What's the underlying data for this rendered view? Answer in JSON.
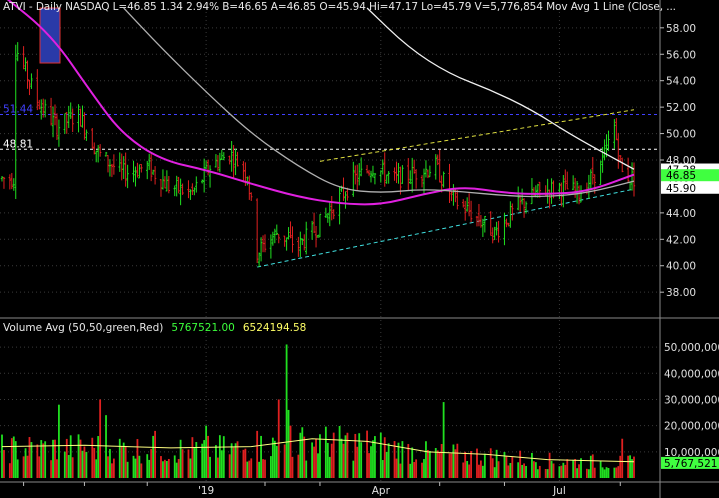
{
  "header": {
    "ticker_line": "ATVI - Daily  NASDAQ  L=46.85  1.34  2.94%  B=46.65  A=46.85  O=45.94  Hi=47.17  Lo=45.79  V=5,776,854  Mov Avg 1 Line (Close, ..."
  },
  "volume_header": {
    "label": "Volume Avg (50,50,green,Red)",
    "avg_value": "5767521.00",
    "prev_value": "6524194.58"
  },
  "colors": {
    "background": "#000000",
    "grid": "#3a3a3a",
    "up": "#20e020",
    "down": "#e02020",
    "ma_magenta": "#e020e0",
    "ma_gray": "#b0b0b0",
    "ma_white": "#f0f0f0",
    "trend_lower": "#40e0e0",
    "trend_upper": "#e0e040",
    "level_blue": "#4040ff",
    "level_white": "#ffffff",
    "last_price": "#40ff40",
    "vol_avg": "#ffff80"
  },
  "chart_data": [
    {
      "type": "candlestick",
      "title": "ATVI - Daily NASDAQ",
      "ylim": [
        36.5,
        59.5
      ],
      "y_ticks": [
        "58.00",
        "56.00",
        "54.00",
        "52.00",
        "50.00",
        "48.00",
        "44.00",
        "42.00",
        "40.00",
        "38.00"
      ],
      "x_ticks": [
        "'19",
        "Apr",
        "Jul"
      ],
      "horizontal_levels": [
        {
          "label": "51.44",
          "value": 51.44,
          "color": "blue"
        },
        {
          "label": "48.81",
          "value": 48.81,
          "color": "white"
        }
      ],
      "price_tags": [
        {
          "label": "47.28",
          "value": 47.28
        },
        {
          "label": "46.66",
          "value": 46.66
        },
        {
          "label": "45.90",
          "value": 45.9
        }
      ],
      "last_price": {
        "label": "46.85",
        "value": 46.85
      },
      "trendlines": [
        {
          "name": "lower-support",
          "points": [
            [
              "2019-01-28",
              39.9
            ],
            [
              "2019-08-08",
              45.8
            ]
          ]
        },
        {
          "name": "upper-resistance",
          "points": [
            [
              "2019-03-01",
              47.9
            ],
            [
              "2019-08-08",
              51.8
            ]
          ]
        }
      ],
      "moving_averages": [
        {
          "name": "magenta",
          "points": [
            [
              "2018-09-20",
              60.5
            ],
            [
              "2018-10-15",
              57.5
            ],
            [
              "2018-11-05",
              53.0
            ],
            [
              "2018-11-20",
              50.0
            ],
            [
              "2018-12-10",
              48.0
            ],
            [
              "2019-01-03",
              47.2
            ],
            [
              "2019-01-25",
              46.2
            ],
            [
              "2019-02-18",
              45.2
            ],
            [
              "2019-03-11",
              44.7
            ],
            [
              "2019-04-01",
              44.6
            ],
            [
              "2019-04-22",
              45.4
            ],
            [
              "2019-05-13",
              46.0
            ],
            [
              "2019-06-03",
              45.5
            ],
            [
              "2019-06-24",
              45.4
            ],
            [
              "2019-07-15",
              45.6
            ],
            [
              "2019-08-08",
              46.9
            ]
          ]
        },
        {
          "name": "gray",
          "points": [
            [
              "2018-11-21",
              59.5
            ],
            [
              "2018-12-10",
              56.5
            ],
            [
              "2019-01-03",
              53.0
            ],
            [
              "2019-01-25",
              50.0
            ],
            [
              "2019-02-18",
              47.5
            ],
            [
              "2019-03-11",
              45.8
            ],
            [
              "2019-04-01",
              45.5
            ],
            [
              "2019-04-22",
              45.8
            ],
            [
              "2019-05-13",
              45.6
            ],
            [
              "2019-06-03",
              45.3
            ],
            [
              "2019-06-24",
              45.2
            ],
            [
              "2019-07-15",
              45.5
            ],
            [
              "2019-08-08",
              46.4
            ]
          ]
        },
        {
          "name": "white",
          "points": [
            [
              "2019-03-25",
              59.5
            ],
            [
              "2019-04-15",
              56.5
            ],
            [
              "2019-05-06",
              54.5
            ],
            [
              "2019-05-27",
              53.3
            ],
            [
              "2019-06-17",
              51.8
            ],
            [
              "2019-07-08",
              49.8
            ],
            [
              "2019-08-08",
              47.3
            ]
          ]
        }
      ],
      "anchors": [
        [
          "2018-09-27",
          56.5
        ],
        [
          "2018-10-08",
          52.5
        ],
        [
          "2018-10-18",
          50.5
        ],
        [
          "2018-10-29",
          51.5
        ],
        [
          "2018-11-08",
          48.5
        ],
        [
          "2018-11-20",
          47.0
        ],
        [
          "2018-12-03",
          47.5
        ],
        [
          "2018-12-14",
          46.0
        ],
        [
          "2018-12-26",
          45.5
        ],
        [
          "2019-01-04",
          47.5
        ],
        [
          "2019-01-14",
          48.5
        ],
        [
          "2019-01-23",
          47.0
        ],
        [
          "2019-01-28",
          41.0
        ],
        [
          "2019-02-07",
          42.5
        ],
        [
          "2019-02-18",
          41.5
        ],
        [
          "2019-02-28",
          43.0
        ],
        [
          "2019-03-08",
          44.5
        ],
        [
          "2019-03-18",
          46.5
        ],
        [
          "2019-03-28",
          47.5
        ],
        [
          "2019-04-08",
          46.5
        ],
        [
          "2019-04-18",
          47.0
        ],
        [
          "2019-04-29",
          47.5
        ],
        [
          "2019-05-08",
          45.0
        ],
        [
          "2019-05-17",
          44.0
        ],
        [
          "2019-05-29",
          42.5
        ],
        [
          "2019-06-10",
          44.5
        ],
        [
          "2019-06-20",
          45.5
        ],
        [
          "2019-07-01",
          46.0
        ],
        [
          "2019-07-11",
          45.5
        ],
        [
          "2019-07-22",
          47.5
        ],
        [
          "2019-07-29",
          50.5
        ],
        [
          "2019-08-02",
          47.0
        ],
        [
          "2019-08-08",
          46.6
        ]
      ]
    },
    {
      "type": "bar",
      "title": "Volume Avg (50,50,green,Red)",
      "ylim": [
        0,
        55000000
      ],
      "y_ticks": [
        "50,000,000",
        "40,000,000",
        "30,000,000",
        "20,000,000",
        "10,000,000"
      ],
      "last_volume_label": "5,767,521",
      "spikes": [
        [
          "2018-10-19",
          28000000
        ],
        [
          "2018-11-09",
          30000000
        ],
        [
          "2018-11-12",
          24000000
        ],
        [
          "2018-12-07",
          18000000
        ],
        [
          "2019-01-02",
          20000000
        ],
        [
          "2019-01-28",
          18000000
        ],
        [
          "2019-02-08",
          30000000
        ],
        [
          "2019-02-12",
          51000000
        ],
        [
          "2019-02-13",
          26000000
        ],
        [
          "2019-02-14",
          20000000
        ],
        [
          "2019-05-03",
          29000000
        ],
        [
          "2019-08-02",
          15000000
        ]
      ],
      "volume_avg": [
        [
          "2018-09-20",
          12000000
        ],
        [
          "2018-11-01",
          12500000
        ],
        [
          "2018-12-15",
          11500000
        ],
        [
          "2019-01-25",
          12000000
        ],
        [
          "2019-02-25",
          15000000
        ],
        [
          "2019-03-25",
          14000000
        ],
        [
          "2019-04-25",
          10000000
        ],
        [
          "2019-05-25",
          9000000
        ],
        [
          "2019-06-25",
          7000000
        ],
        [
          "2019-08-08",
          6200000
        ]
      ]
    }
  ]
}
